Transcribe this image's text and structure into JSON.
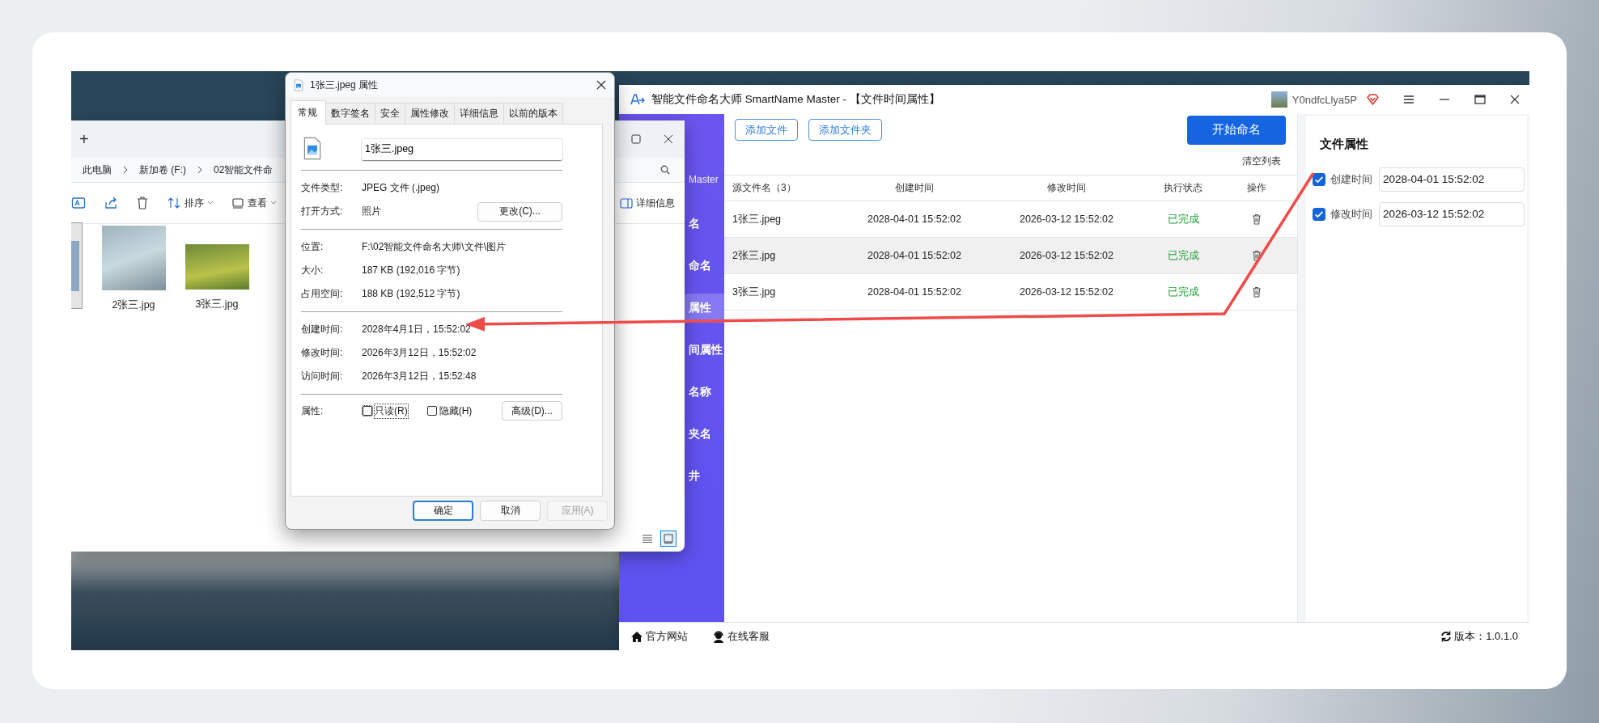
{
  "explorer": {
    "new_tab": "+",
    "breadcrumb": [
      "此电脑",
      "新加卷 (F:)",
      "02智能文件命"
    ],
    "toolbar": [
      {
        "kind": "rename"
      },
      {
        "kind": "share"
      },
      {
        "kind": "delete"
      },
      {
        "kind": "sort",
        "label": "排序"
      },
      {
        "kind": "view",
        "label": "查看"
      }
    ],
    "details_pane": "详细信息",
    "files": [
      {
        "selected": true
      },
      {
        "name": "2张三.jpg",
        "selected": false
      },
      {
        "name": "3张三.jpg",
        "selected": false
      }
    ],
    "view_modes": [
      {
        "kind": "details",
        "selected": false
      },
      {
        "kind": "tiles",
        "selected": true
      }
    ]
  },
  "dialog": {
    "title": "1张三.jpeg 属性",
    "tabs": [
      {
        "label": "常规",
        "selected": true
      },
      {
        "label": "数字签名",
        "selected": false
      },
      {
        "label": "安全",
        "selected": false
      },
      {
        "label": "属性修改",
        "selected": false
      },
      {
        "label": "详细信息",
        "selected": false
      },
      {
        "label": "以前的版本",
        "selected": false
      }
    ],
    "file_name": "1张三.jpeg",
    "groups": [
      [
        {
          "label": "文件类型:",
          "value": "JPEG 文件 (.jpeg)"
        },
        {
          "label": "打开方式:",
          "value": "照片",
          "button": "更改(C)..."
        }
      ],
      [
        {
          "label": "位置:",
          "value": "F:\\02智能文件命名大师\\文件\\图片"
        },
        {
          "label": "大小:",
          "value": "187 KB (192,016 字节)"
        },
        {
          "label": "占用空间:",
          "value": "188 KB (192,512 字节)"
        }
      ],
      [
        {
          "label": "创建时间:",
          "value": "2028年4月1日，15:52:02"
        },
        {
          "label": "修改时间:",
          "value": "2026年3月12日，15:52:02"
        },
        {
          "label": "访问时间:",
          "value": "2026年3月12日，15:52:48"
        }
      ]
    ],
    "attributes": {
      "label": "属性:",
      "checkboxes": [
        {
          "label": "只读(R)",
          "checked": false,
          "focused": true
        },
        {
          "label": "隐藏(H)",
          "checked": false,
          "focused": false
        }
      ],
      "button": "高级(D)..."
    },
    "buttons": [
      {
        "label": "确定",
        "default": true,
        "disabled": false
      },
      {
        "label": "取消",
        "default": false,
        "disabled": false
      },
      {
        "label": "应用(A)",
        "default": false,
        "disabled": true
      }
    ]
  },
  "app": {
    "title": "智能文件命名大师 SmartName Master - 【文件时间属性】",
    "user": "Y0ndfcLlya5P",
    "sidebar": {
      "brand": "Master",
      "items": [
        {
          "label": "名",
          "selected": false
        },
        {
          "label": "命名",
          "selected": false
        },
        {
          "label": "属性",
          "selected": true
        },
        {
          "label": "间属性",
          "selected": false
        },
        {
          "label": "名称",
          "selected": false
        },
        {
          "label": "夹名",
          "selected": false
        },
        {
          "label": "井",
          "selected": false
        }
      ]
    },
    "actions": [
      "添加文件",
      "添加文件夹"
    ],
    "start_button": "开始命名",
    "clear_list": "清空列表",
    "table": {
      "columns": [
        "源文件名（3）",
        "创建时间",
        "修改时间",
        "执行状态",
        "操作"
      ],
      "rows": [
        {
          "name": "1张三.jpeg",
          "created": "2028-04-01 15:52:02",
          "modified": "2026-03-12 15:52:02",
          "status": "已完成",
          "kind": "done",
          "selected": false
        },
        {
          "name": "2张三.jpg",
          "created": "2028-04-01 15:52:02",
          "modified": "2026-03-12 15:52:02",
          "status": "已完成",
          "kind": "done",
          "selected": true
        },
        {
          "name": "3张三.jpg",
          "created": "2028-04-01 15:52:02",
          "modified": "2026-03-12 15:52:02",
          "status": "已完成",
          "kind": "done",
          "selected": false
        }
      ]
    },
    "panel": {
      "title": "文件属性",
      "fields": [
        {
          "label": "创建时间",
          "checked": true,
          "value": "2028-04-01 15:52:02"
        },
        {
          "label": "修改时间",
          "checked": true,
          "value": "2026-03-12 15:52:02"
        }
      ]
    },
    "footer": {
      "links": [
        {
          "kind": "home",
          "label": "官方网站"
        },
        {
          "kind": "support",
          "label": "在线客服"
        }
      ],
      "version": "版本：1.0.1.0"
    }
  }
}
